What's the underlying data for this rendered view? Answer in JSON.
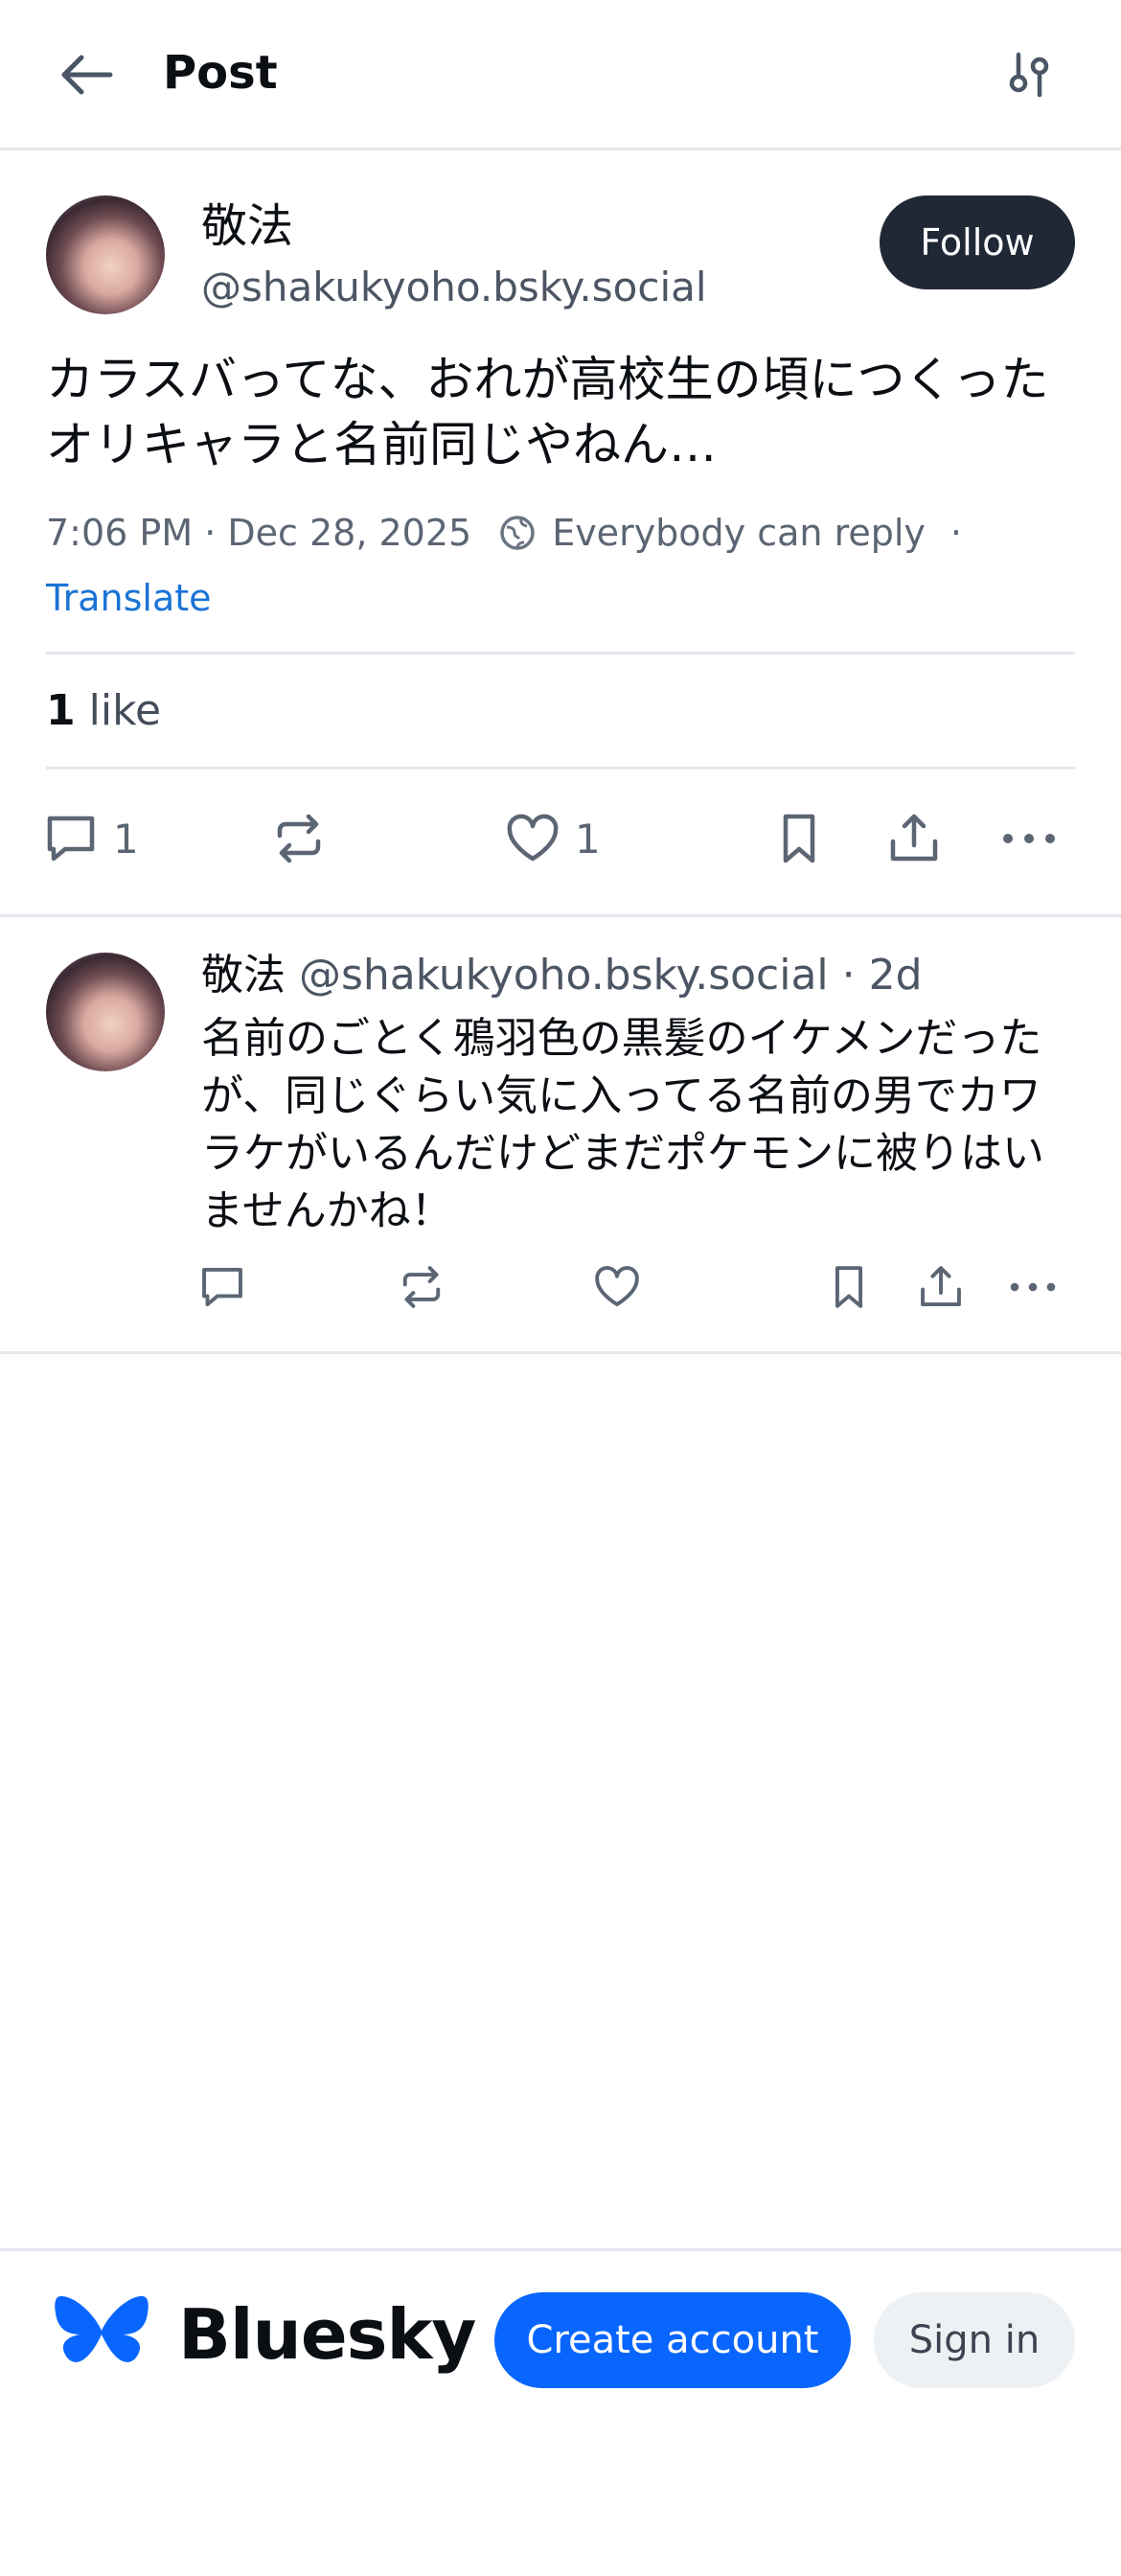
{
  "header": {
    "title": "Post",
    "back_icon": "arrow-left-icon",
    "filter_icon": "sliders-icon"
  },
  "post": {
    "author_name": "敬法",
    "author_handle": "@shakukyoho.bsky.social",
    "follow_label": "Follow",
    "text_line1": "カラスバってな、おれが高校生の頃につくった",
    "text_line2": "オリキャラと名前同じやねん…",
    "timestamp": "7:06 PM · Dec 28, 2025",
    "reply_setting": "Everybody can reply",
    "separator": "·",
    "translate_label": "Translate",
    "like_count": "1",
    "like_word": "like",
    "actions": {
      "reply_count": "1",
      "like_count": "1"
    }
  },
  "reply": {
    "author_name": "敬法",
    "author_handle": "@shakukyoho.bsky.social",
    "age": "· 2d",
    "line1": "名前のごとく鴉羽色の黒髪のイケメンだった",
    "line2": "が、同じぐらい気に入ってる名前の男でカワ",
    "line3": "ラケがいるんだけどまだポケモンに被りはい",
    "line4": "ませんかね！"
  },
  "footer": {
    "brand": "Bluesky",
    "create_account": "Create account",
    "sign_in": "Sign in"
  },
  "colors": {
    "accent": "#0866ff",
    "link": "#1a73d6",
    "follow_bg": "#202836"
  }
}
